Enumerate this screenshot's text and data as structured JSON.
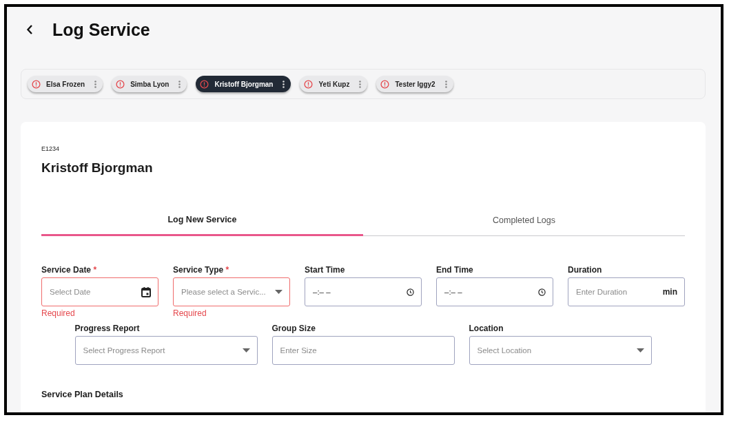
{
  "header": {
    "title": "Log Service"
  },
  "clients": [
    {
      "name": "Elsa Frozen",
      "selected": false
    },
    {
      "name": "Simba Lyon",
      "selected": false
    },
    {
      "name": "Kristoff Bjorgman",
      "selected": true
    },
    {
      "name": "Yeti Kupz",
      "selected": false
    },
    {
      "name": "Tester Iggy2",
      "selected": false
    }
  ],
  "client": {
    "id": "E1234",
    "name": "Kristoff Bjorgman"
  },
  "tabs": [
    {
      "label": "Log New Service",
      "selected": true
    },
    {
      "label": "Completed Logs",
      "selected": false
    }
  ],
  "field_rows": [
    {
      "fields": [
        {
          "kind": "date",
          "label": "Service Date",
          "required_mark": "*",
          "placeholder": "Select Date",
          "error": "Required"
        },
        {
          "kind": "select",
          "label": "Service Type",
          "required_mark": "*",
          "placeholder": "Please select a Servic...",
          "error": "Required"
        },
        {
          "kind": "time",
          "label": "Start Time",
          "placeholder": "–:– –"
        },
        {
          "kind": "time",
          "label": "End Time",
          "placeholder": "–:– –"
        },
        {
          "kind": "unit",
          "label": "Duration",
          "placeholder": "Enter Duration",
          "unit": "min"
        }
      ]
    },
    {
      "fields": [
        {
          "kind": "select",
          "label": "Progress Report",
          "placeholder": "Select Progress Report"
        },
        {
          "kind": "text",
          "label": "Group Size",
          "placeholder": "Enter Size"
        },
        {
          "kind": "select",
          "label": "Location",
          "placeholder": "Select Location"
        }
      ]
    }
  ],
  "section": {
    "title": "Service Plan Details"
  }
}
